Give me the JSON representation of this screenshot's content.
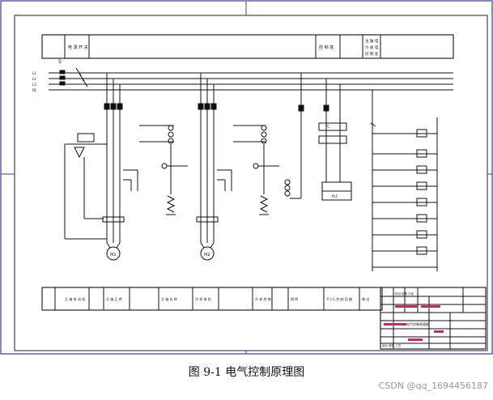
{
  "caption": "图 9-1  电气控制原理图",
  "watermark": "CSDN @qq_1694456187",
  "header": {
    "block_a": "电 源 开 关",
    "block_b": "控 制 变",
    "block_c": [
      "主 轴 电",
      "冷 却 电",
      "控 制 变"
    ],
    "under_mark": "S"
  },
  "bus_labels": [
    "L1",
    "L2",
    "L3",
    "PE"
  ],
  "footer_cells": [
    "主 轴 电 动 机",
    "主 轴 正 转",
    "主 轴 反 转",
    "冷 却 电 机",
    "冷 却 控 制",
    "照 明",
    "P L C 控 制 回 路",
    "输 出"
  ],
  "title_block": {
    "title": "电气控制原理图",
    "small_a": "标记 处数 分区",
    "small_b": "设计 审核 工艺"
  },
  "motor_labels": [
    "M1",
    "M2"
  ],
  "transformer_label": "TC",
  "plc_label": "PLC"
}
